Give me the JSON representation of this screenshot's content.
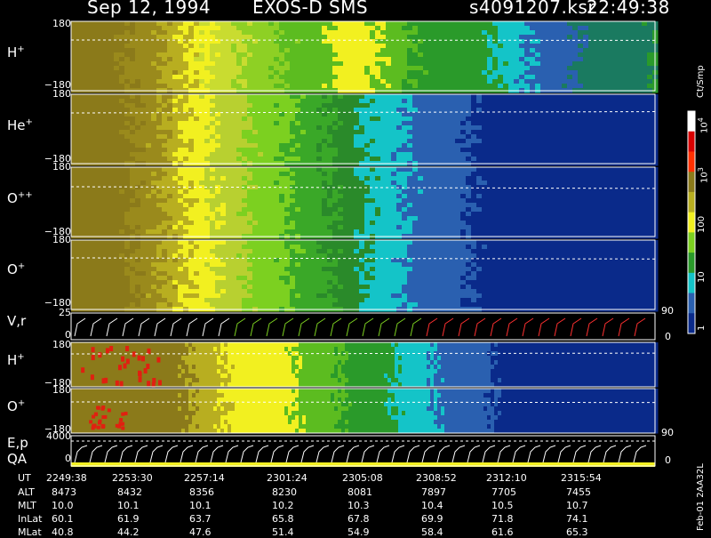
{
  "header": {
    "date": "Sep 12, 1994",
    "instrument": "EXOS-D SMS",
    "file": "s4091207.ksr",
    "time": "22:49:38"
  },
  "panels": [
    {
      "label_base": "H",
      "label_sup": "+",
      "top": "180",
      "bottom": "−180"
    },
    {
      "label_base": "He",
      "label_sup": "+",
      "top": "180",
      "bottom": "−180"
    },
    {
      "label_base": "O",
      "label_sup": "++",
      "top": "180",
      "bottom": "−180"
    },
    {
      "label_base": "O",
      "label_sup": "+",
      "top": "180",
      "bottom": "−180"
    },
    {
      "label_base": "V,r",
      "label_sup": "",
      "top": "25",
      "bottom": "0"
    },
    {
      "label_base": "H",
      "label_sup": "+",
      "top": "180",
      "bottom": "−180"
    },
    {
      "label_base": "O",
      "label_sup": "+",
      "top": "180",
      "bottom": "−180"
    }
  ],
  "ep_panel": {
    "label1": "E,p",
    "label2": "QA",
    "top": "4000",
    "bottom": "0"
  },
  "colorbar": {
    "unit": "Ct/Smp",
    "ticks": [
      {
        "base": "10",
        "sup": "4"
      },
      {
        "base": "10",
        "sup": "3"
      },
      {
        "base": "100",
        "sup": ""
      },
      {
        "base": "10",
        "sup": ""
      },
      {
        "base": "1",
        "sup": ""
      }
    ],
    "colors": [
      "#ffffff",
      "#d80000",
      "#ff3000",
      "#8b7a1a",
      "#b8ae20",
      "#f2f020",
      "#7cd020",
      "#2a9a2a",
      "#14c4c8",
      "#2a60b0",
      "#0a2a8a"
    ]
  },
  "right_axis": {
    "vr_top": "90",
    "vr_bottom": "0",
    "pa_top": "90",
    "ep_bottom": "0"
  },
  "footer": {
    "tag": "Feb-01 2AA32L"
  },
  "ephemeris": {
    "row_labels": [
      "UT",
      "ALT",
      "MLT",
      "InLat",
      "MLat"
    ],
    "columns": [
      [
        "2249:38",
        "8473",
        "10.0",
        "60.1",
        "40.8"
      ],
      [
        "2253:30",
        "8432",
        "10.1",
        "61.9",
        "44.2"
      ],
      [
        "2257:14",
        "8356",
        "10.1",
        "63.7",
        "47.6"
      ],
      [
        "2301:24",
        "8230",
        "10.2",
        "65.8",
        "51.4"
      ],
      [
        "2305:08",
        "8081",
        "10.3",
        "67.8",
        "54.9"
      ],
      [
        "2308:52",
        "7897",
        "10.4",
        "69.9",
        "58.4"
      ],
      [
        "2312:10",
        "7705",
        "10.5",
        "71.8",
        "61.6"
      ],
      [
        "2315:54",
        "7455",
        "10.7",
        "74.1",
        "65.3"
      ]
    ]
  },
  "chart_data": {
    "type": "heatmap",
    "title": "Sep 12, 1994 EXOS-D SMS",
    "x": [
      "2249:38",
      "2253:30",
      "2257:14",
      "2301:24",
      "2305:08",
      "2308:52",
      "2312:10",
      "2315:54"
    ],
    "series": [
      {
        "name": "H+",
        "ylim": [
          -180,
          180
        ]
      },
      {
        "name": "He+",
        "ylim": [
          -180,
          180
        ]
      },
      {
        "name": "O++",
        "ylim": [
          -180,
          180
        ]
      },
      {
        "name": "O+",
        "ylim": [
          -180,
          180
        ]
      },
      {
        "name": "V,r",
        "ylim": [
          0,
          25
        ]
      },
      {
        "name": "H+",
        "ylim": [
          -180,
          180
        ]
      },
      {
        "name": "O+",
        "ylim": [
          -180,
          180
        ]
      },
      {
        "name": "E,p",
        "ylim": [
          0,
          4000
        ]
      }
    ],
    "colorbar": {
      "label": "Ct/Smp",
      "scale": "log",
      "range": [
        1,
        10000
      ]
    }
  }
}
